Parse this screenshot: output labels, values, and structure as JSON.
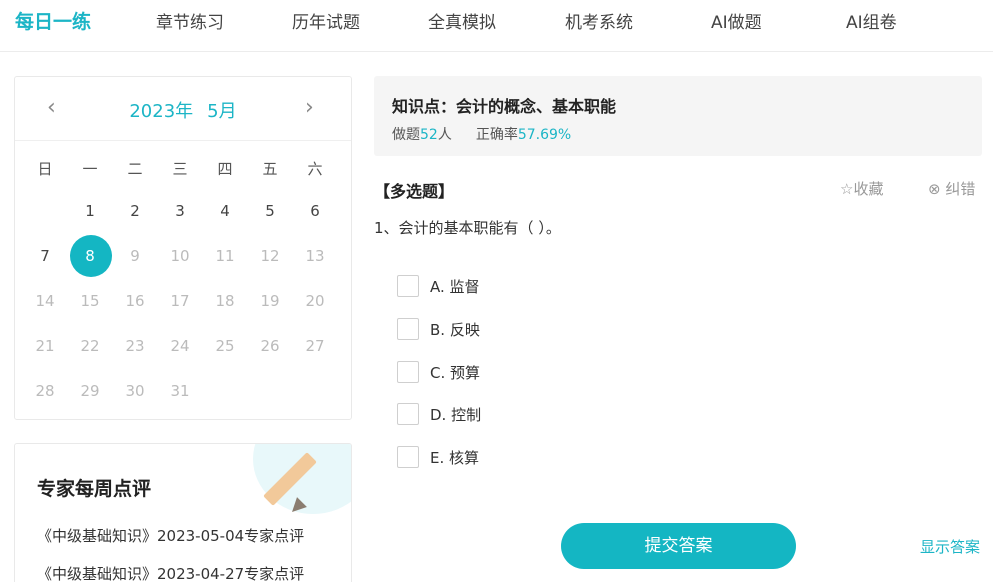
{
  "nav": {
    "tabs": [
      {
        "label": "每日一练",
        "active": true
      },
      {
        "label": "章节练习",
        "active": false
      },
      {
        "label": "历年试题",
        "active": false
      },
      {
        "label": "全真模拟",
        "active": false
      },
      {
        "label": "机考系统",
        "active": false
      },
      {
        "label": "AI做题",
        "active": false
      },
      {
        "label": "AI组卷",
        "active": false
      }
    ]
  },
  "calendar": {
    "prev": "‹",
    "next": "›",
    "year": "2023年",
    "month": "5月",
    "weekdays": [
      "日",
      "一",
      "二",
      "三",
      "四",
      "五",
      "六"
    ],
    "days": [
      "1",
      "2",
      "3",
      "4",
      "5",
      "6",
      "7",
      "8",
      "9",
      "10",
      "11",
      "12",
      "13",
      "14",
      "15",
      "16",
      "17",
      "18",
      "19",
      "20",
      "21",
      "22",
      "23",
      "24",
      "25",
      "26",
      "27",
      "28",
      "29",
      "30",
      "31"
    ],
    "first_weekday": 1,
    "selected_day": "8",
    "available_through": 8
  },
  "expert": {
    "title": "专家每周点评",
    "links": [
      "《中级基础知识》2023-05-04专家点评",
      "《中级基础知识》2023-04-27专家点评"
    ]
  },
  "knowledge": {
    "title": "知识点：会计的概念、基本职能",
    "count_prefix": "做题",
    "count": "52",
    "count_suffix": "人",
    "rate_prefix": "正确率",
    "rate": "57.69%"
  },
  "question": {
    "type": "【多选题】",
    "favorite": "☆收藏",
    "report_error": "⊗ 纠错",
    "text": "1、会计的基本职能有（   ）。",
    "options": [
      "A. 监督",
      "B. 反映",
      "C. 预算",
      "D. 控制",
      "E. 核算"
    ]
  },
  "actions": {
    "submit": "提交答案",
    "show_answer": "显示答案"
  },
  "colors": {
    "accent": "#14b6c3"
  }
}
